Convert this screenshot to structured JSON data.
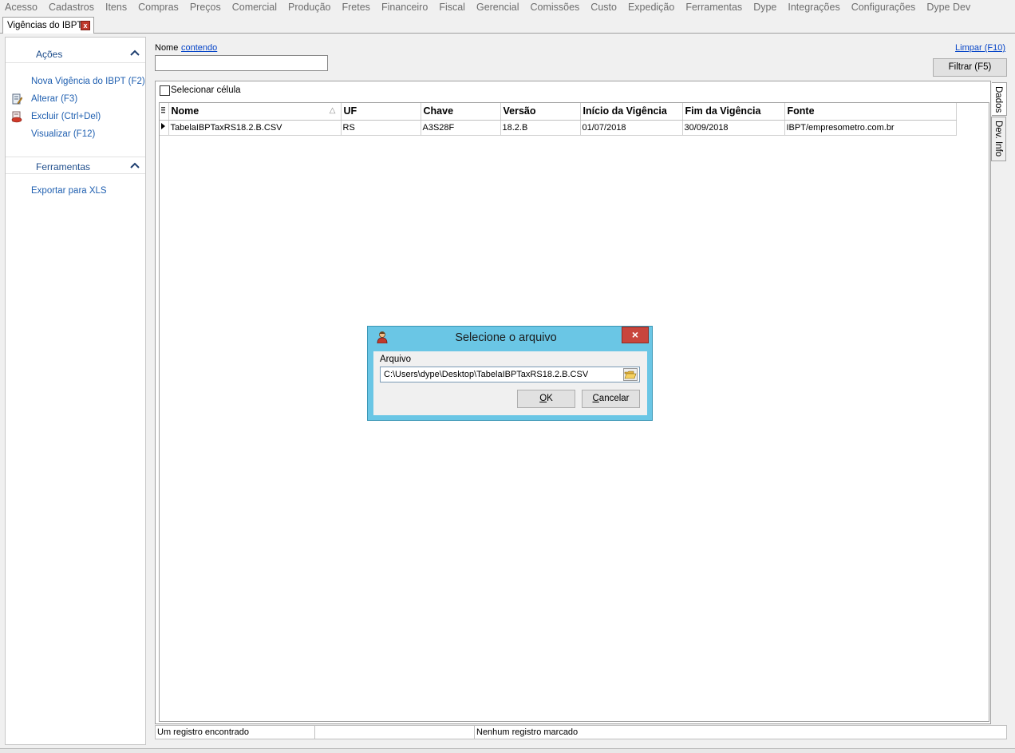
{
  "menu": [
    "Acesso",
    "Cadastros",
    "Itens",
    "Compras",
    "Preços",
    "Comercial",
    "Produção",
    "Fretes",
    "Financeiro",
    "Fiscal",
    "Gerencial",
    "Comissões",
    "Custo",
    "Expedição",
    "Ferramentas",
    "Dype",
    "Integrações",
    "Configurações",
    "Dype Dev"
  ],
  "doc_tab": {
    "label": "Vigências do IBPT",
    "close": "x"
  },
  "left_panel": {
    "actions_title": "Ações",
    "actions": [
      {
        "label": "Nova Vigência do IBPT (F2)",
        "icon": ""
      },
      {
        "label": "Alterar (F3)",
        "icon": "edit-icon"
      },
      {
        "label": "Excluir (Ctrl+Del)",
        "icon": "delete-icon"
      },
      {
        "label": "Visualizar (F12)",
        "icon": ""
      }
    ],
    "tools_title": "Ferramentas",
    "tools": [
      {
        "label": "Exportar para XLS"
      }
    ]
  },
  "filter": {
    "field_label": "Nome",
    "operator": "contendo",
    "value": "",
    "clear_label": "Limpar (F10)",
    "filter_button": "Filtrar (F5)"
  },
  "grid": {
    "select_cell_label": "Selecionar célula",
    "columns": [
      "Nome",
      "UF",
      "Chave",
      "Versão",
      "Início da Vigência",
      "Fim da Vigência",
      "Fonte"
    ],
    "rows": [
      [
        "TabelaIBPTaxRS18.2.B.CSV",
        "RS",
        "A3S28F",
        "18.2.B",
        "01/07/2018",
        "30/09/2018",
        "IBPT/empresometro.com.br"
      ]
    ]
  },
  "side_tabs": [
    "Dados",
    "Dev. Info"
  ],
  "status": {
    "records": "Um registro encontrado",
    "middle": "",
    "marked": "Nenhum registro marcado"
  },
  "dialog": {
    "title": "Selecione o arquivo",
    "field_label": "Arquivo",
    "path": "C:\\Users\\dype\\Desktop\\TabelaIBPTaxRS18.2.B.CSV",
    "ok": "OK",
    "cancel": "Cancelar",
    "colors": {
      "titlebar": "#6ac6e5",
      "close": "#c8453c"
    }
  }
}
